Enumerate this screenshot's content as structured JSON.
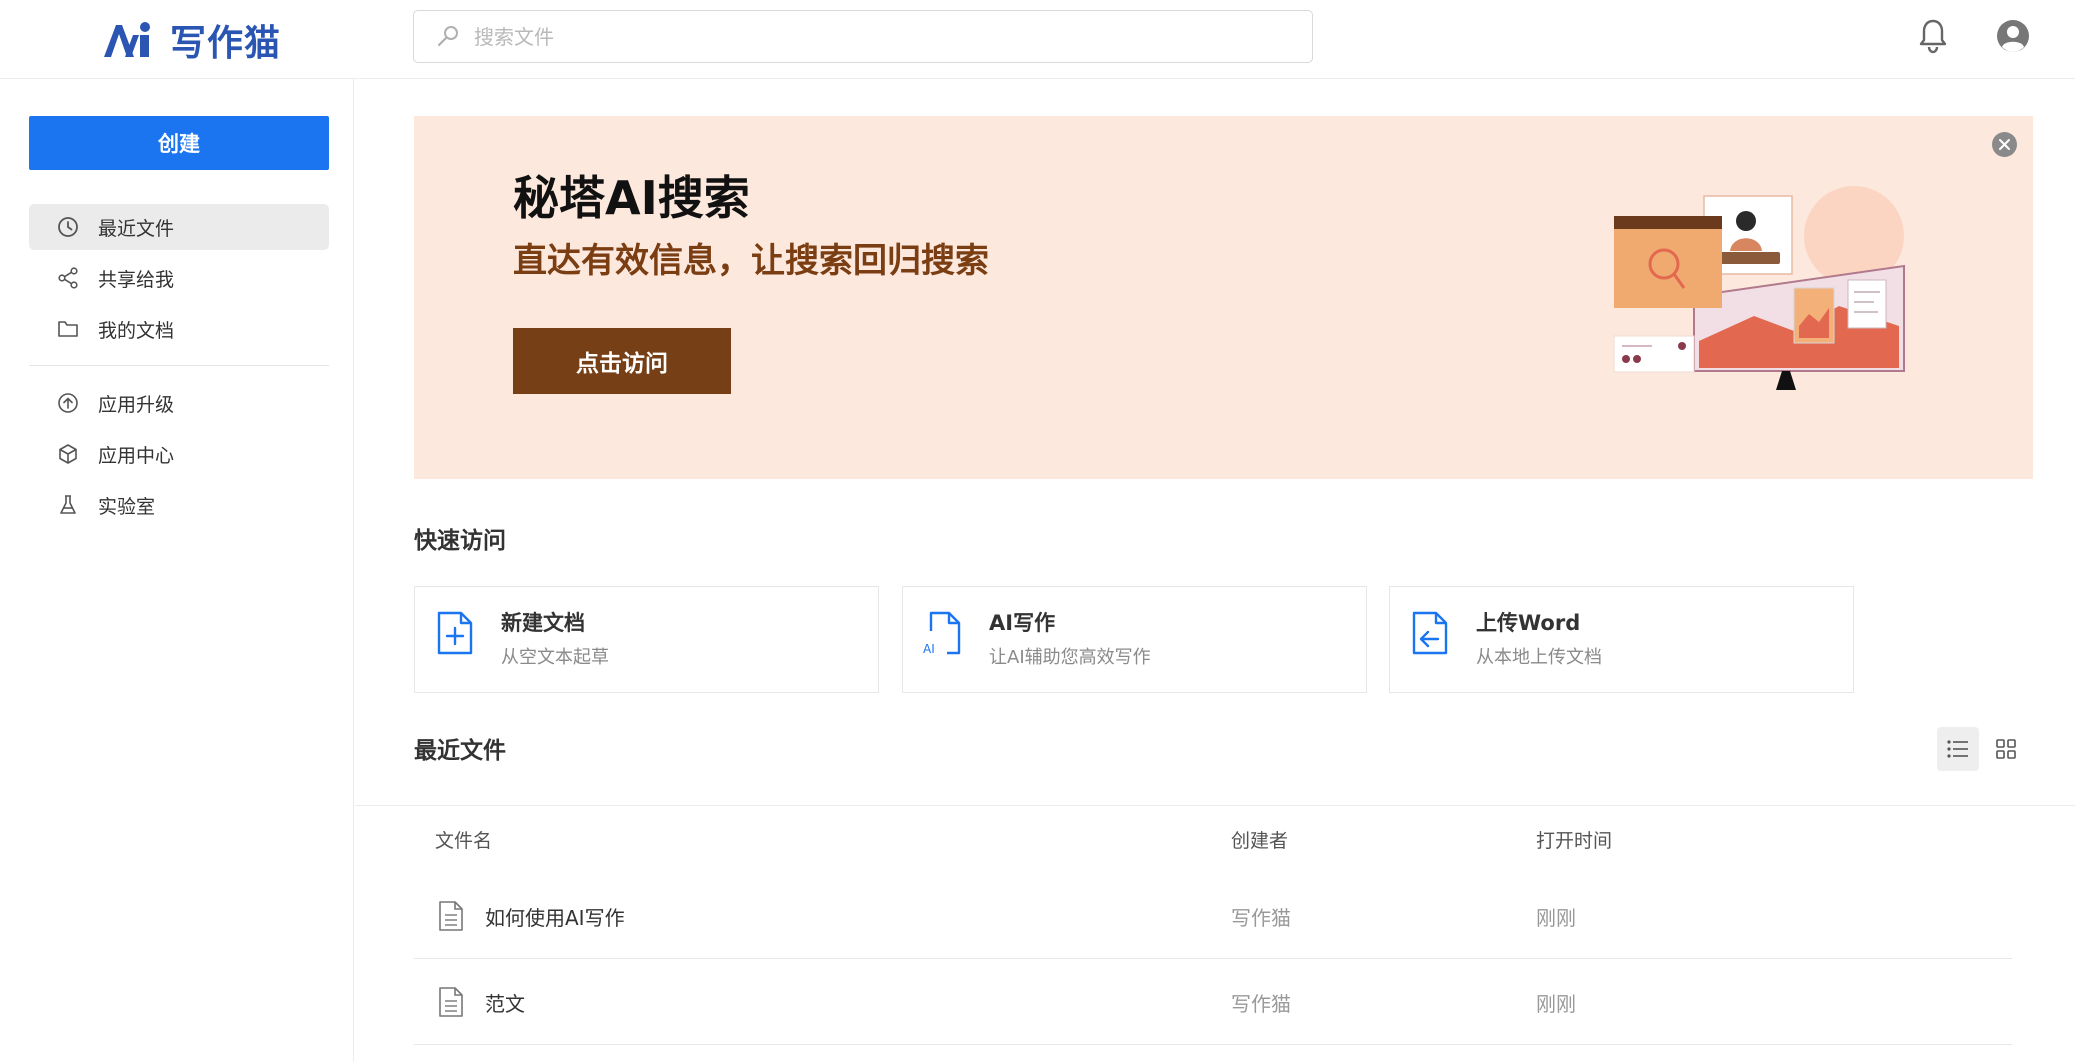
{
  "header": {
    "logo_text": "写作猫",
    "search_placeholder": "搜索文件"
  },
  "sidebar": {
    "create_label": "创建",
    "items": [
      {
        "label": "最近文件",
        "icon": "clock-icon",
        "active": true
      },
      {
        "label": "共享给我",
        "icon": "share-icon",
        "active": false
      },
      {
        "label": "我的文档",
        "icon": "folder-icon",
        "active": false
      },
      {
        "label": "应用升级",
        "icon": "arrow-up-circle-icon",
        "active": false
      },
      {
        "label": "应用中心",
        "icon": "cube-icon",
        "active": false
      },
      {
        "label": "实验室",
        "icon": "flask-icon",
        "active": false
      }
    ]
  },
  "banner": {
    "title": "秘塔AI搜索",
    "subtitle": "直达有效信息，让搜索回归搜索",
    "button_label": "点击访问",
    "background": "#fde8de",
    "button_color": "#763f15"
  },
  "quick_access": {
    "title": "快速访问",
    "cards": [
      {
        "title": "新建文档",
        "desc": "从空文本起草",
        "icon": "file-plus-icon"
      },
      {
        "title": "AI写作",
        "desc": "让AI辅助您高效写作",
        "icon": "file-ai-icon"
      },
      {
        "title": "上传Word",
        "desc": "从本地上传文档",
        "icon": "file-upload-icon"
      }
    ]
  },
  "recent": {
    "title": "最近文件",
    "columns": {
      "name": "文件名",
      "creator": "创建者",
      "time": "打开时间"
    },
    "rows": [
      {
        "name": "如何使用AI写作",
        "creator": "写作猫",
        "time": "刚刚"
      },
      {
        "name": "范文",
        "creator": "写作猫",
        "time": "刚刚"
      }
    ]
  },
  "colors": {
    "accent": "#1b74f0",
    "logo": "#2a55b3"
  }
}
